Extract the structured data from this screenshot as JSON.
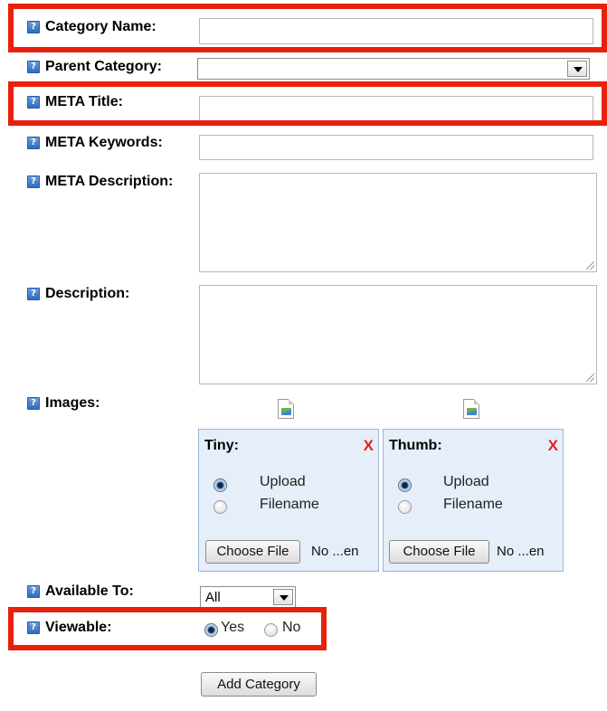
{
  "form": {
    "category_name_label": "Category Name:",
    "parent_category_label": "Parent Category:",
    "parent_category_value": "",
    "meta_title_label": "META Title:",
    "meta_keywords_label": "META Keywords:",
    "meta_description_label": "META Description:",
    "description_label": "Description:",
    "images_label": "Images:",
    "available_to_label": "Available To:",
    "available_to_value": "All",
    "viewable_label": "Viewable:",
    "viewable_yes": "Yes",
    "viewable_no": "No",
    "viewable_selected": "Yes",
    "submit_label": "Add Category"
  },
  "images": {
    "tiny": {
      "title": "Tiny:",
      "remove": "X",
      "upload_label": "Upload",
      "filename_label": "Filename",
      "selected": "Upload",
      "choose_file_label": "Choose File",
      "no_file_text": "No ...en"
    },
    "thumb": {
      "title": "Thumb:",
      "remove": "X",
      "upload_label": "Upload",
      "filename_label": "Filename",
      "selected": "Upload",
      "choose_file_label": "Choose File",
      "no_file_text": "No ...en"
    }
  },
  "icons": {
    "help": "help-icon",
    "dropdown": "chevron-down-icon",
    "image_placeholder": "broken-image-icon"
  },
  "colors": {
    "highlight": "#e8200c",
    "help_icon": "#3a78c8",
    "remove_x": "#e2211c",
    "image_panel_bg": "#e6eefa"
  }
}
